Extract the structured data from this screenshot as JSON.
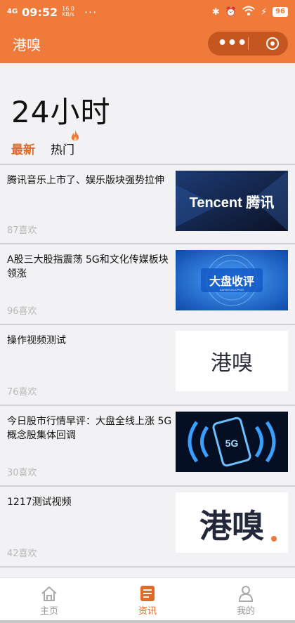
{
  "status_bar": {
    "network": "4G",
    "time": "09:52",
    "speed_value": "16.0",
    "speed_unit": "KB/s",
    "more": "···",
    "battery": "96"
  },
  "navbar": {
    "title": "港嗅",
    "menu_icon": "more-dots-icon",
    "close_icon": "record-close-icon"
  },
  "page": {
    "title": "24小时",
    "tabs": [
      {
        "label": "最新",
        "active": true
      },
      {
        "label": "热门",
        "active": false
      }
    ]
  },
  "news": [
    {
      "title": "腾讯音乐上市了、娱乐版块强势拉伸",
      "likes": "87喜欢",
      "thumb_text": "Tencent 腾讯"
    },
    {
      "title": "A股三大股指震荡 5G和文化传媒板块领涨",
      "likes": "96喜欢",
      "thumb_text": "大盘收评",
      "thumb_sub": "DAPANSHOUPING"
    },
    {
      "title": "操作视频测试",
      "likes": "76喜欢",
      "thumb_text": "港嗅"
    },
    {
      "title": "今日股市行情早评：大盘全线上涨 5G概念股集体回调",
      "likes": "30喜欢",
      "thumb_text": "5G"
    },
    {
      "title": "1217测试视频",
      "likes": "42喜欢",
      "thumb_text": "港嗅"
    }
  ],
  "tabbar": [
    {
      "label": "主页",
      "icon": "home-icon",
      "active": false
    },
    {
      "label": "资讯",
      "icon": "news-icon",
      "active": true
    },
    {
      "label": "我的",
      "icon": "user-icon",
      "active": false
    }
  ],
  "colors": {
    "accent": "#f07a3a",
    "active_text": "#e06a28",
    "likes": "#b8b8b8"
  }
}
